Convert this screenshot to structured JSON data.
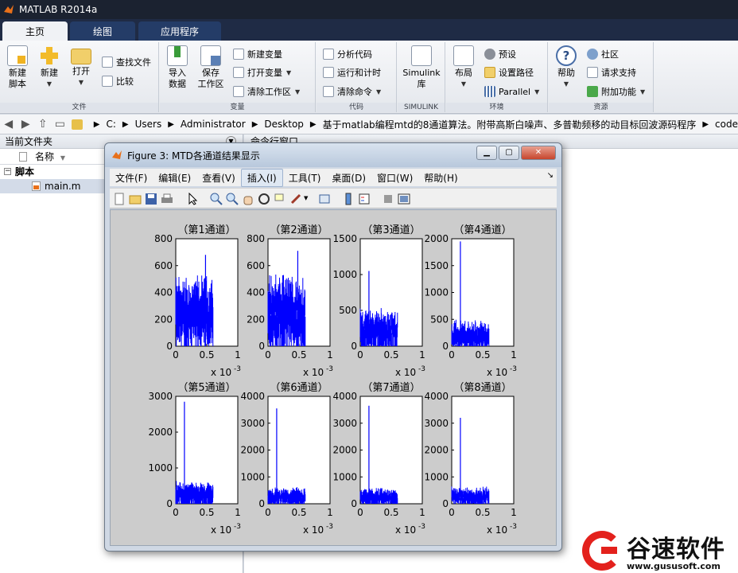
{
  "app": {
    "title": "MATLAB R2014a"
  },
  "tabs": [
    {
      "label": "主页",
      "active": true
    },
    {
      "label": "绘图",
      "active": false
    },
    {
      "label": "应用程序",
      "active": false
    }
  ],
  "ribbon": {
    "file": {
      "group_label": "文件",
      "new_script": "新建\n脚本",
      "new": "新建",
      "open": "打开",
      "find_files": "查找文件",
      "compare": "比较"
    },
    "variable": {
      "group_label": "变量",
      "import": "导入\n数据",
      "save_ws": "保存\n工作区",
      "new_var": "新建变量",
      "open_var": "打开变量",
      "clear_ws": "清除工作区"
    },
    "code": {
      "group_label": "代码",
      "analyze": "分析代码",
      "run_time": "运行和计时",
      "clear_cmd": "清除命令"
    },
    "simulink": {
      "group_label": "SIMULINK",
      "lib": "Simulink\n库"
    },
    "env": {
      "group_label": "环境",
      "layout": "布局",
      "prefs": "预设",
      "set_path": "设置路径",
      "parallel": "Parallel"
    },
    "resources": {
      "group_label": "资源",
      "help": "帮助",
      "community": "社区",
      "support": "请求支持",
      "addons": "附加功能"
    }
  },
  "address": {
    "parts": [
      "C:",
      "Users",
      "Administrator",
      "Desktop",
      "基于matlab编程mtd的8通道算法。附带高斯白噪声、多普勒频移的动目标回波源码程序",
      "code"
    ]
  },
  "left_panel": {
    "title": "当前文件夹",
    "col_name": "名称",
    "folder": "脚本",
    "file": "main.m"
  },
  "cmd_panel": {
    "title": "命令行窗口"
  },
  "figure": {
    "title": "Figure 3: MTD各通道结果显示",
    "menu": [
      "文件(F)",
      "编辑(E)",
      "查看(V)",
      "插入(I)",
      "工具(T)",
      "桌面(D)",
      "窗口(W)",
      "帮助(H)"
    ],
    "highlighted_menu_index": 3
  },
  "chart_data": [
    {
      "type": "line",
      "title": "（第1通道）",
      "ylim": [
        0,
        800
      ],
      "yticks": [
        0,
        200,
        400,
        600,
        800
      ],
      "xlim": [
        0,
        0.001
      ],
      "xticks": [
        "0",
        "0.5",
        "1"
      ],
      "x_exponent": "x 10",
      "x_exp_power": "-3",
      "peak": 680,
      "noise_level": 250,
      "noise_spread": 160,
      "series_color": "#0000ff"
    },
    {
      "type": "line",
      "title": "（第2通道）",
      "ylim": [
        0,
        800
      ],
      "yticks": [
        0,
        200,
        400,
        600,
        800
      ],
      "xlim": [
        0,
        0.001
      ],
      "xticks": [
        "0",
        "0.5",
        "1"
      ],
      "x_exponent": "x 10",
      "x_exp_power": "-3",
      "peak": 710,
      "noise_level": 250,
      "noise_spread": 160,
      "series_color": "#0000ff"
    },
    {
      "type": "line",
      "title": "（第3通道）",
      "ylim": [
        0,
        1500
      ],
      "yticks": [
        0,
        500,
        1000,
        1500
      ],
      "xlim": [
        0,
        0.001
      ],
      "xticks": [
        "0",
        "0.5",
        "1"
      ],
      "x_exponent": "x 10",
      "x_exp_power": "-3",
      "peak": 1050,
      "noise_level": 230,
      "noise_spread": 170,
      "series_color": "#0000ff"
    },
    {
      "type": "line",
      "title": "（第4通道）",
      "ylim": [
        0,
        2000
      ],
      "yticks": [
        0,
        500,
        1000,
        1500,
        2000
      ],
      "xlim": [
        0,
        0.001
      ],
      "xticks": [
        "0",
        "0.5",
        "1"
      ],
      "x_exponent": "x 10",
      "x_exp_power": "-3",
      "peak": 1950,
      "noise_level": 200,
      "noise_spread": 160,
      "series_color": "#0000ff"
    },
    {
      "type": "line",
      "title": "（第5通道）",
      "ylim": [
        0,
        3000
      ],
      "yticks": [
        0,
        1000,
        2000,
        3000
      ],
      "xlim": [
        0,
        0.001
      ],
      "xticks": [
        "0",
        "0.5",
        "1"
      ],
      "x_exponent": "x 10",
      "x_exp_power": "-3",
      "peak": 2850,
      "noise_level": 250,
      "noise_spread": 220,
      "series_color": "#0000ff"
    },
    {
      "type": "line",
      "title": "（第6通道）",
      "ylim": [
        0,
        4000
      ],
      "yticks": [
        0,
        1000,
        2000,
        3000,
        4000
      ],
      "xlim": [
        0,
        0.001
      ],
      "xticks": [
        "0",
        "0.5",
        "1"
      ],
      "x_exponent": "x 10",
      "x_exp_power": "-3",
      "peak": 3550,
      "noise_level": 250,
      "noise_spread": 200,
      "series_color": "#0000ff"
    },
    {
      "type": "line",
      "title": "（第7通道）",
      "ylim": [
        0,
        4000
      ],
      "yticks": [
        0,
        1000,
        2000,
        3000,
        4000
      ],
      "xlim": [
        0,
        0.001
      ],
      "xticks": [
        "0",
        "0.5",
        "1"
      ],
      "x_exponent": "x 10",
      "x_exp_power": "-3",
      "peak": 3650,
      "noise_level": 250,
      "noise_spread": 200,
      "series_color": "#0000ff"
    },
    {
      "type": "line",
      "title": "（第8通道）",
      "ylim": [
        0,
        4000
      ],
      "yticks": [
        0,
        1000,
        2000,
        3000,
        4000
      ],
      "xlim": [
        0,
        0.001
      ],
      "xticks": [
        "0",
        "0.5",
        "1"
      ],
      "x_exponent": "x 10",
      "x_exp_power": "-3",
      "peak": 3200,
      "noise_level": 280,
      "noise_spread": 200,
      "series_color": "#0000ff"
    }
  ],
  "watermark": {
    "brand": "谷速软件",
    "url": "www.gususoft.com",
    "color": "#e3211c"
  }
}
